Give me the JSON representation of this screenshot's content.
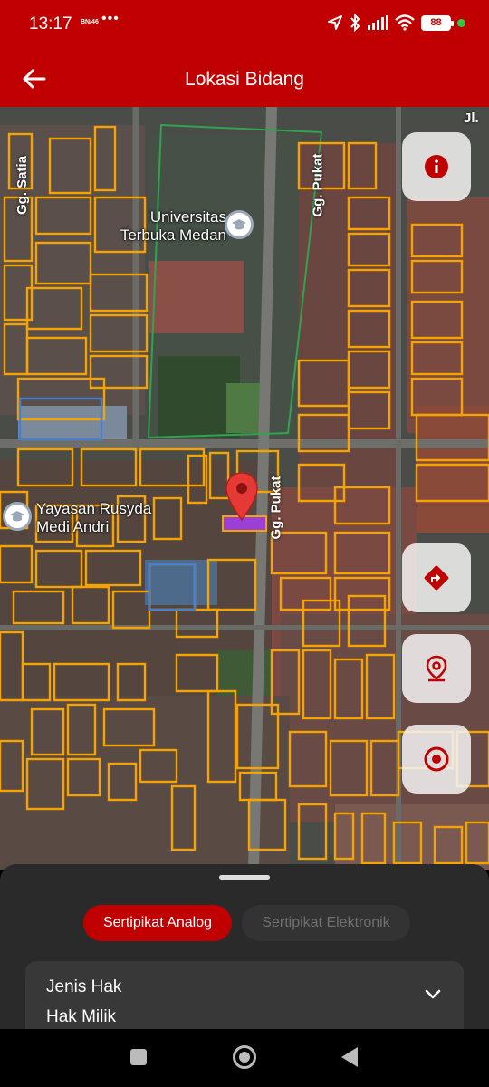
{
  "status": {
    "time": "13:17",
    "network": "BN/46",
    "dots": "•••",
    "battery": "88"
  },
  "app_bar": {
    "title": "Lokasi Bidang"
  },
  "map": {
    "places": {
      "university": "Universitas Terbuka Medan",
      "foundation": "Yayasan Rusyda Medi Andri"
    },
    "streets": {
      "gg_satia": "Gg. Satia",
      "gg_pukat_top": "Gg. Pukat",
      "gg_pukat_mid": "Gg. Pukat",
      "jl": "Jl."
    },
    "buttons": [
      "info-icon",
      "directions-icon",
      "location-pin-icon",
      "target-icon"
    ]
  },
  "sheet": {
    "tabs": {
      "analog": "Sertipikat Analog",
      "elektronik": "Sertipikat Elektronik"
    },
    "card": {
      "label": "Jenis Hak",
      "value": "Hak Milik"
    }
  },
  "colors": {
    "brand_red": "#c00000",
    "parcel_outline": "#f5a300",
    "selected_parcel": "#9b3fd6",
    "sheet_bg": "#2a2a2a"
  }
}
